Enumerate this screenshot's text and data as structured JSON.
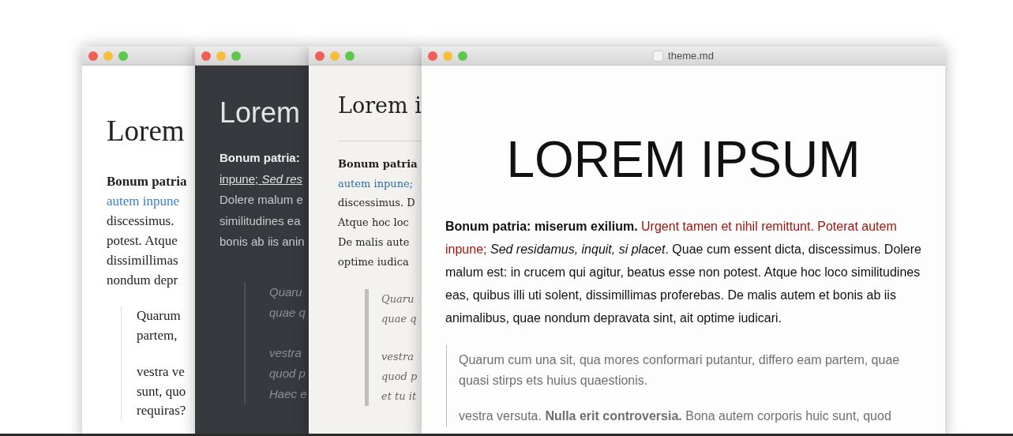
{
  "windows": [
    {
      "kind": "paper",
      "heading": "Lorem",
      "heading_rule": false,
      "lines": [
        {
          "text": "Bonum patria",
          "kind": "bold"
        },
        {
          "text": "autem inpune",
          "kind": "link"
        },
        {
          "text": "discessimus.",
          "kind": "plain"
        },
        {
          "text": "potest. Atque",
          "kind": "plain"
        },
        {
          "text": "dissimillimas",
          "kind": "plain"
        },
        {
          "text": "nondum depr",
          "kind": "plain"
        }
      ],
      "quote": [
        [
          "Quarum",
          "partem,"
        ],
        [
          "vestra ve",
          "sunt, quo",
          "requiras?"
        ]
      ]
    },
    {
      "kind": "dark",
      "heading": "Lorem",
      "heading_rule": false,
      "lines": [
        {
          "text": "Bonum patria:",
          "kind": "bold"
        },
        {
          "text": "inpune",
          "kind": "link",
          "tail": "; *Sed res*"
        },
        {
          "text": "Dolere malum e",
          "kind": "plain"
        },
        {
          "text": "similitudines ea",
          "kind": "plain"
        },
        {
          "text": "bonis ab iis anin",
          "kind": "plain"
        }
      ],
      "quote": [
        [
          "Quaru",
          "quae q"
        ],
        [
          "vestra",
          "quod p",
          "Haec e"
        ]
      ]
    },
    {
      "kind": "cream",
      "heading": "Lorem i",
      "heading_rule": true,
      "lines": [
        {
          "text": "Bonum patria",
          "kind": "bold"
        },
        {
          "text": "autem inpune;",
          "kind": "link"
        },
        {
          "text": "discessimus. D",
          "kind": "plain"
        },
        {
          "text": "Atque hoc loc",
          "kind": "plain"
        },
        {
          "text": "De malis aute",
          "kind": "plain"
        },
        {
          "text": "optime iudica",
          "kind": "plain"
        }
      ],
      "quote": [
        [
          "Quaru",
          "quae q"
        ],
        [
          "vestra",
          "quod p",
          "et tu it"
        ]
      ]
    },
    {
      "kind": "plain",
      "title": "theme.md",
      "heading": "LOREM IPSUM",
      "heading_rule": false,
      "paragraph": [
        {
          "text": "**Bonum patria: miserum exilium.** ",
          "kind": "plain"
        },
        {
          "text": "Urgent tamen et nihil remittunt. Poterat autem inpune;",
          "kind": "link"
        },
        {
          "text": " *Sed residamus, inquit, si placet*. Quae cum essent dicta, discessimus. Dolere malum est: in crucem qui agitur, beatus esse non potest. Atque hoc loco similitudines eas, quibus illi uti solent, dissimillimas proferebas. De malis autem et bonis ab iis animalibus, quae nondum depravata sint, ait optime iudicari.",
          "kind": "plain"
        }
      ],
      "quote_paragraphs": [
        "Quarum cum una sit, qua mores conformari putantur, differo eam partem, quae quasi stirps ets huius quaestionis.",
        "vestra versuta. **Nulla erit controversia.** Bona autem corporis huic sunt, quod"
      ]
    }
  ]
}
